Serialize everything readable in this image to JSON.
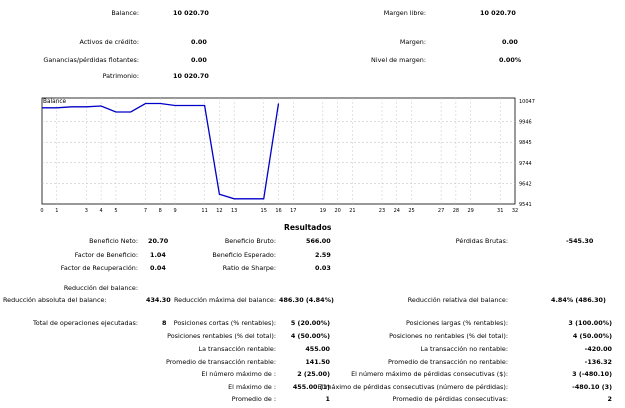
{
  "summary": {
    "left": [
      {
        "label": "Balance:",
        "value": "10 020.70"
      },
      {
        "label": "Activos de crédito:",
        "value": "0.00"
      },
      {
        "label": "Ganancias/pérdidas flotantes:",
        "value": "0.00"
      },
      {
        "label": "Patrimonio:",
        "value": "10 020.70"
      }
    ],
    "right": [
      {
        "label": "Margen libre:",
        "value": "10 020.70"
      },
      {
        "label": "Margen:",
        "value": "0.00"
      },
      {
        "label": "Nivel de margen:",
        "value": "0.00%"
      }
    ]
  },
  "chart_data": {
    "type": "line",
    "title": "Balance",
    "series": [
      {
        "name": "Balance",
        "x": [
          0,
          1,
          2,
          3,
          4,
          5,
          6,
          7,
          8,
          9,
          10,
          11,
          12,
          13,
          14,
          15,
          16
        ],
        "y": [
          10000,
          10000,
          10005,
          10005,
          10009,
          9980,
          9980,
          10020.7,
          10020.7,
          10011,
          10011,
          10011,
          9588,
          9566,
          9566,
          9566,
          10020.7
        ]
      }
    ],
    "x_ticks": [
      "0",
      "1",
      "3",
      "4",
      "5",
      "7",
      "8",
      "9",
      "11",
      "12",
      "13",
      "15",
      "16",
      "17",
      "19",
      "20",
      "21",
      "23",
      "24",
      "25",
      "27",
      "28",
      "29",
      "31",
      "32"
    ],
    "y_ticks": [
      "10047",
      "9946",
      "9845",
      "9744",
      "9642",
      "9541"
    ],
    "xlim": [
      0,
      32
    ],
    "ylim": [
      9541,
      10047
    ],
    "grid": true
  },
  "results": {
    "title": "Resultados",
    "row1": [
      {
        "label": "Beneficio Neto:",
        "value": "20.70"
      },
      {
        "label": "Beneficio Bruto:",
        "value": "566.00"
      },
      {
        "label": "Pérdidas Brutas:",
        "value": "-545.30"
      }
    ],
    "row2": [
      {
        "label": "Factor de Beneficio:",
        "value": "1.04"
      },
      {
        "label": "Beneficio Esperado:",
        "value": "2.59"
      }
    ],
    "row3": [
      {
        "label": "Factor de Recuperación:",
        "value": "0.04"
      },
      {
        "label": "Ratio de Sharpe:",
        "value": "0.03"
      }
    ],
    "reduccion_title": "Reducción del balance:",
    "reduccion": [
      {
        "label": "Reducción absoluta del balance:",
        "value": "434.30"
      },
      {
        "label": "Reducción máxima del balance:",
        "value": "486.30 (4.84%)"
      },
      {
        "label": "Reducción relativa del balance:",
        "value": "4.84% (486.30)"
      }
    ],
    "trades_total": {
      "label": "Total de operaciones ejecutadas:",
      "value": "8"
    },
    "mid_rows": [
      {
        "label": "Posiciones cortas (% rentables):",
        "value": "5 (20.00%)"
      },
      {
        "label": "Posiciones rentables (% del total):",
        "value": "4 (50.00%)"
      },
      {
        "label": "La transacción rentable:",
        "value": "455.00"
      },
      {
        "label": "Promedio de transacción rentable:",
        "value": "141.50"
      },
      {
        "label": "El número máximo de :",
        "value": "2 (25.00)"
      },
      {
        "label": "El máximo de :",
        "value": "455.00 (1)"
      },
      {
        "label": "Promedio de :",
        "value": "1"
      }
    ],
    "right_rows": [
      {
        "label": "Posiciones largas (% rentables):",
        "value": "3 (100.00%)"
      },
      {
        "label": "Posiciones no rentables (% del total):",
        "value": "4 (50.00%)"
      },
      {
        "label": "La transacción no rentable:",
        "value": "-420.00"
      },
      {
        "label": "Promedio de transacción no rentable:",
        "value": "-136.32"
      },
      {
        "label": "El número máximo de pérdidas consecutivas ($):",
        "value": "3 (-480.10)"
      },
      {
        "label": "El máximo de pérdidas consecutivas (número de pérdidas):",
        "value": "-480.10 (3)"
      },
      {
        "label": "Promedio de pérdidas consecutivas:",
        "value": "2"
      }
    ]
  }
}
